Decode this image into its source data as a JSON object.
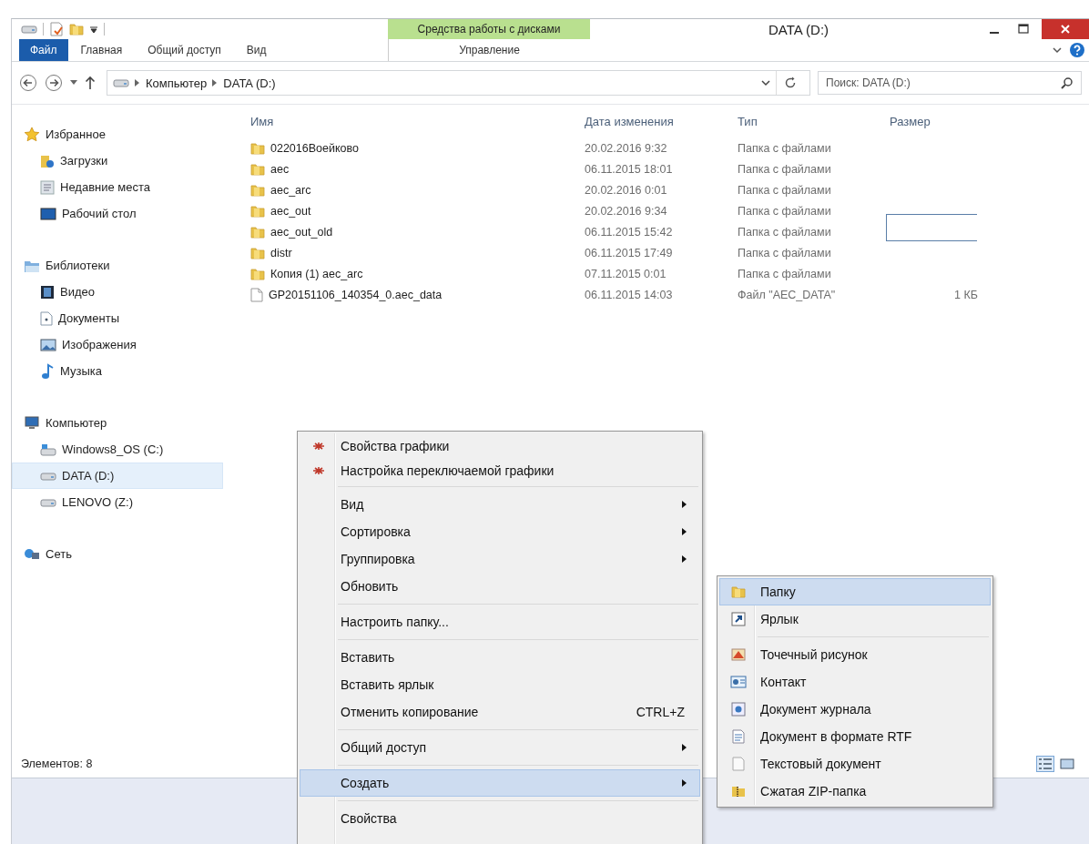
{
  "title_bar": {
    "title": "DATA (D:)",
    "context_group": "Средства работы с дисками"
  },
  "ribbon_tabs": [
    {
      "label": "Файл",
      "kind": "file"
    },
    {
      "label": "Главная",
      "kind": "tab"
    },
    {
      "label": "Общий доступ",
      "kind": "tab"
    },
    {
      "label": "Вид",
      "kind": "tab"
    },
    {
      "label": "Управление",
      "kind": "context"
    }
  ],
  "address_bar": {
    "path": [
      "Компьютер",
      "DATA (D:)"
    ]
  },
  "search": {
    "placeholder": "Поиск: DATA (D:)"
  },
  "sidebar": [
    {
      "label": "Избранное",
      "selected": false,
      "children": [
        {
          "label": "Загрузки",
          "selected": false
        },
        {
          "label": "Недавние места",
          "selected": false
        },
        {
          "label": "Рабочий стол",
          "selected": false
        }
      ]
    },
    {
      "label": "Библиотеки",
      "selected": false,
      "children": [
        {
          "label": "Видео",
          "selected": false
        },
        {
          "label": "Документы",
          "selected": false
        },
        {
          "label": "Изображения",
          "selected": false
        },
        {
          "label": "Музыка",
          "selected": false
        }
      ]
    },
    {
      "label": "Компьютер",
      "selected": false,
      "children": [
        {
          "label": "Windows8_OS (C:)",
          "selected": false
        },
        {
          "label": "DATA (D:)",
          "selected": true
        },
        {
          "label": "LENOVO (Z:)",
          "selected": false
        }
      ]
    },
    {
      "label": "Сеть",
      "selected": false
    }
  ],
  "table": {
    "columns": [
      "Имя",
      "Дата изменения",
      "Тип",
      "Размер"
    ],
    "rows": [
      {
        "kind": "folder",
        "name": "022016Воейково",
        "modified": "20.02.2016 9:32",
        "type": "Папка с файлами"
      },
      {
        "kind": "folder",
        "name": "aec",
        "modified": "06.11.2015 18:01",
        "type": "Папка с файлами"
      },
      {
        "kind": "folder",
        "name": "aec_arc",
        "modified": "20.02.2016 0:01",
        "type": "Папка с файлами"
      },
      {
        "kind": "folder",
        "name": "aec_out",
        "modified": "20.02.2016 9:34",
        "type": "Папка с файлами"
      },
      {
        "kind": "folder",
        "name": "aec_out_old",
        "modified": "06.11.2015 15:42",
        "type": "Папка с файлами"
      },
      {
        "kind": "folder",
        "name": "distr",
        "modified": "06.11.2015 17:49",
        "type": "Папка с файлами"
      },
      {
        "kind": "folder",
        "name": "Копия (1) aec_arc",
        "modified": "07.11.2015 0:01",
        "type": "Папка с файлами"
      },
      {
        "kind": "file",
        "name": "GP20151106_140354_0.aec_data",
        "modified": "06.11.2015 14:03",
        "type": "Файл \"AEC_DATA\"",
        "size": "1 КБ"
      }
    ]
  },
  "status_bar": {
    "item_count": "Элементов: 8"
  },
  "context_menu": {
    "groups": [
      [
        {
          "label": "Свойства графики",
          "kind": "graphics",
          "submenu": false,
          "selected": false
        },
        {
          "label": "Настройка переключаемой графики",
          "kind": "graphics",
          "submenu": false,
          "selected": false
        }
      ],
      [
        {
          "label": "Вид",
          "kind": "plain",
          "submenu": true,
          "selected": false
        },
        {
          "label": "Сортировка",
          "kind": "plain",
          "submenu": true,
          "selected": false
        },
        {
          "label": "Группировка",
          "kind": "plain",
          "submenu": true,
          "selected": false
        },
        {
          "label": "Обновить",
          "kind": "plain",
          "submenu": false,
          "selected": false
        }
      ],
      [
        {
          "label": "Настроить папку...",
          "kind": "plain",
          "submenu": false,
          "selected": false
        }
      ],
      [
        {
          "label": "Вставить",
          "kind": "plain",
          "submenu": false,
          "selected": false
        },
        {
          "label": "Вставить ярлык",
          "kind": "plain",
          "submenu": false,
          "selected": false
        },
        {
          "label": "Отменить копирование",
          "kind": "plain",
          "submenu": false,
          "selected": false,
          "shortcut": "CTRL+Z"
        }
      ],
      [
        {
          "label": "Общий доступ",
          "kind": "plain",
          "submenu": true,
          "selected": false
        }
      ],
      [
        {
          "label": "Создать",
          "kind": "plain",
          "submenu": true,
          "selected": true
        }
      ],
      [
        {
          "label": "Свойства",
          "kind": "plain",
          "submenu": false,
          "selected": false
        }
      ]
    ]
  },
  "create_submenu": {
    "groups": [
      [
        {
          "label": "Папку",
          "kind": "folder",
          "selected": true
        },
        {
          "label": "Ярлык",
          "kind": "shortcut",
          "selected": false
        }
      ],
      [
        {
          "label": "Точечный рисунок",
          "kind": "bitmap",
          "selected": false
        },
        {
          "label": "Контакт",
          "kind": "contact",
          "selected": false
        },
        {
          "label": "Документ журнала",
          "kind": "journal",
          "selected": false
        },
        {
          "label": "Документ в формате RTF",
          "kind": "rtf",
          "selected": false
        },
        {
          "label": "Текстовый документ",
          "kind": "text",
          "selected": false
        },
        {
          "label": "Сжатая ZIP-папка",
          "kind": "zip",
          "selected": false
        }
      ]
    ]
  }
}
